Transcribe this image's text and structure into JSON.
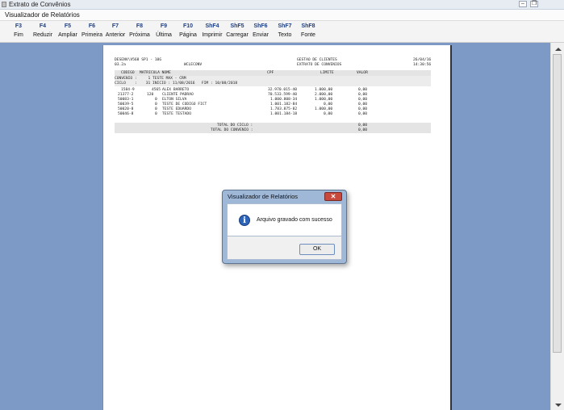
{
  "window": {
    "outer_title": "Extrato de Convênios",
    "inner_title": "Visualizador de Relatórios",
    "min_glyph": "–",
    "restore_glyph": "❐"
  },
  "toolbar": [
    {
      "key": "F3",
      "label": "Fim"
    },
    {
      "key": "F4",
      "label": "Reduzir"
    },
    {
      "key": "F5",
      "label": "Ampliar"
    },
    {
      "key": "F6",
      "label": "Primeira"
    },
    {
      "key": "F7",
      "label": "Anterior"
    },
    {
      "key": "F8",
      "label": "Próxima"
    },
    {
      "key": "F9",
      "label": "Última"
    },
    {
      "key": "F10",
      "label": "Página"
    },
    {
      "key": "ShF4",
      "label": "Imprimir"
    },
    {
      "key": "ShF5",
      "label": "Carregar"
    },
    {
      "key": "ShF6",
      "label": "Enviar"
    },
    {
      "key": "ShF7",
      "label": "Texto"
    },
    {
      "key": "ShF8",
      "label": "Fonte"
    }
  ],
  "report": {
    "header_left1": "DESENV\\V568 SP1 - 10G",
    "header_center1": "GESTAO DE CLIENTES",
    "header_right1": "26/04/16",
    "header_left2": "03.2a",
    "header_mid2": "WCLECONV",
    "header_center2": "EXTRATO DE CONVENIOS",
    "header_right2": "14:30:56",
    "columns": {
      "codigo": "CODIGO",
      "matricula_nome": "MATRICULA NOME",
      "cpf": "CPF",
      "limite": "LIMITE",
      "valor": "VALOR"
    },
    "convenio_line": "CONVENIO :     1 TESTE MAX - CRM",
    "ciclo_line": "CICLO    :    31 INICIO : 11/08/2016   FIM : 10/08/2018",
    "rows": [
      {
        "codigo": "1584-9",
        "matricula": "4565",
        "nome": "ALEX BARRETO",
        "cpf": "32.970.015-40",
        "limite": "1.000,00",
        "valor": "0,00"
      },
      {
        "codigo": "21377-2",
        "matricula": "120",
        "nome": "CLIENTE PADRAO",
        "cpf": "70.533.599-40",
        "limite": "2.000,00",
        "valor": "0,00"
      },
      {
        "codigo": "50083-1",
        "matricula": "0",
        "nome": "ELTON SILVA",
        "cpf": "1.000.808-34",
        "limite": "1.000,00",
        "valor": "0,00"
      },
      {
        "codigo": "50039-5",
        "matricula": "0",
        "nome": "TESTE DE CODIGO FICT",
        "cpf": "1.001.182-84",
        "limite": "0,00",
        "valor": "0,00"
      },
      {
        "codigo": "50020-8",
        "matricula": "0",
        "nome": "TESTE EDUARDO",
        "cpf": "1.783.875-82",
        "limite": "1.000,00",
        "valor": "0,00"
      },
      {
        "codigo": "50046-8",
        "matricula": "0",
        "nome": "TESTE TESTADO",
        "cpf": "1.001.184-18",
        "limite": "0,00",
        "valor": "0,00"
      }
    ],
    "total_ciclo_label": "TOTAL DO CICLO :",
    "total_ciclo_value": "0,00",
    "total_convenio_label": "TOTAL DO CONVENIO :",
    "total_convenio_value": "0,00"
  },
  "dialog": {
    "title": "Visualizador de Relatórios",
    "close_glyph": "✕",
    "icon_glyph": "i",
    "message": "Arquivo gravado com sucesso",
    "ok_label": "OK"
  }
}
